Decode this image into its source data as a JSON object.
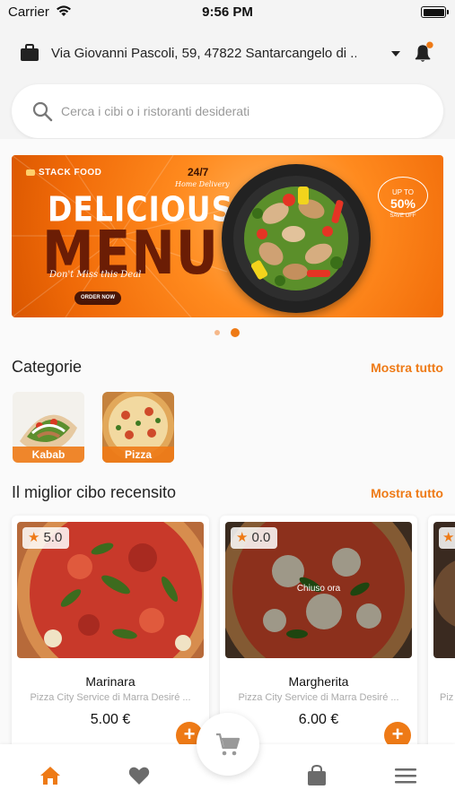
{
  "status_bar": {
    "carrier": "Carrier",
    "time": "9:56 PM"
  },
  "header": {
    "address": "Via Giovanni Pascoli, 59, 47822 Santarcangelo di ...",
    "icons": [
      "briefcase-icon",
      "chevron-down-icon",
      "bell-icon"
    ],
    "notification_dot": true
  },
  "search": {
    "placeholder": "Cerca i cibi o i ristoranti desiderati",
    "icon": "search-icon"
  },
  "banner": {
    "brand": "STACK FOOD",
    "title_top": "DELICIOUS",
    "title_bottom": "MENU",
    "tagline": "Don't Miss this Deal",
    "button": "ORDER NOW",
    "delivery": "24/7",
    "delivery_sub": "Home Delivery",
    "badge_top": "UP TO",
    "badge_value": "50%",
    "badge_bottom": "SAVE  OFF",
    "pages": 2,
    "active_page": 2
  },
  "categories": {
    "title": "Categorie",
    "link": "Mostra tutto",
    "items": [
      {
        "label": "Kabab"
      },
      {
        "label": "Pizza"
      }
    ]
  },
  "best_reviewed": {
    "title": "Il miglior cibo recensito",
    "link": "Mostra tutto",
    "items": [
      {
        "rating": "5.0",
        "name": "Marinara",
        "restaurant": "Pizza City Service di Marra Desiré ...",
        "price": "5.00 €",
        "closed": ""
      },
      {
        "rating": "0.0",
        "name": "Margherita",
        "restaurant": "Pizza City Service di Marra Desiré ...",
        "price": "6.00 €",
        "closed": "Chiuso ora"
      },
      {
        "rating": "",
        "name": "",
        "restaurant": "Piz",
        "price": "",
        "closed": ""
      }
    ]
  },
  "colors": {
    "accent": "#ee7a16",
    "background": "#f4f4f4",
    "nav_inactive": "#6b6b6b"
  },
  "bottom_nav": [
    "home-icon",
    "heart-icon",
    "cart-icon",
    "shopping-bag-icon",
    "menu-icon"
  ]
}
